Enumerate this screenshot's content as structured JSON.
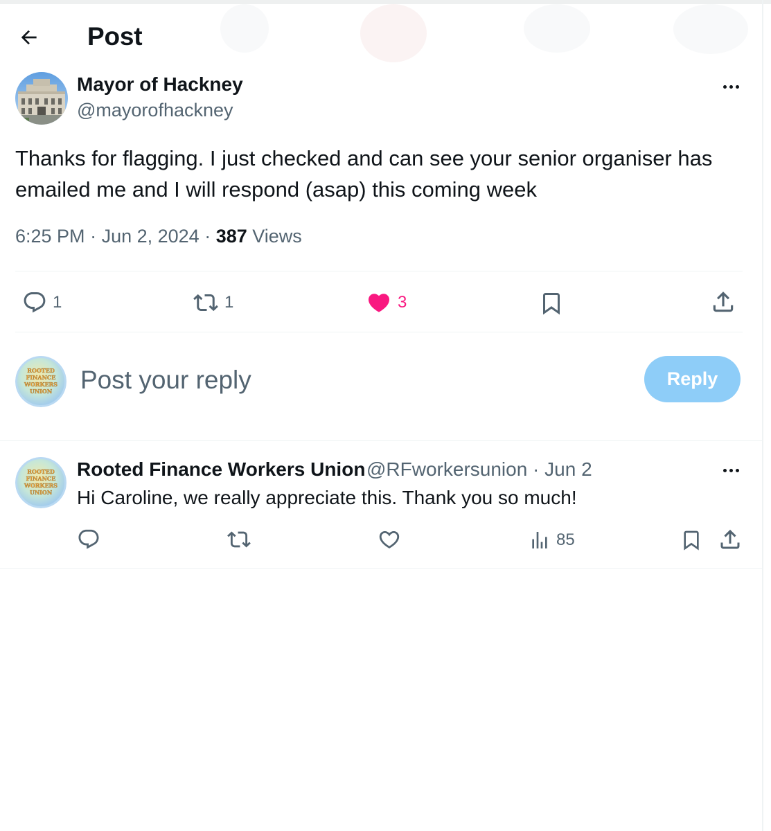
{
  "header": {
    "title": "Post"
  },
  "post": {
    "author_name": "Mayor of Hackney",
    "author_handle": "@mayorofhackney",
    "text": "Thanks for flagging. I just checked and can see your senior organiser has emailed me and I will respond (asap) this coming week",
    "time": "6:25 PM",
    "separator": " · ",
    "date": "Jun 2, 2024",
    "views_count": "387",
    "views_label": "Views",
    "stats": {
      "replies": "1",
      "reposts": "1",
      "likes": "3"
    }
  },
  "reply_box": {
    "placeholder": "Post your reply",
    "button_label": "Reply",
    "avatar_logo_text": "ROOTED FINANCE WORKERS UNION"
  },
  "comment": {
    "author_name": "Rooted Finance Workers Union",
    "author_handle": "@RFworkersunion · Jun 2",
    "text": "Hi Caroline, we really appreciate this. Thank you so much!",
    "views": "85",
    "avatar_logo_text": "ROOTED FINANCE WORKERS UNION"
  },
  "colors": {
    "text_primary": "#0f1419",
    "text_secondary": "#536471",
    "like_active": "#f91880",
    "reply_button_disabled": "#8ecdf8",
    "divider": "#eff3f4"
  },
  "icons": {
    "back": "arrow-left-icon",
    "more": "more-horizontal-icon",
    "reply": "reply-icon",
    "repost": "repost-icon",
    "like": "heart-icon",
    "bookmark": "bookmark-icon",
    "share": "share-icon",
    "views": "views-chart-icon"
  }
}
